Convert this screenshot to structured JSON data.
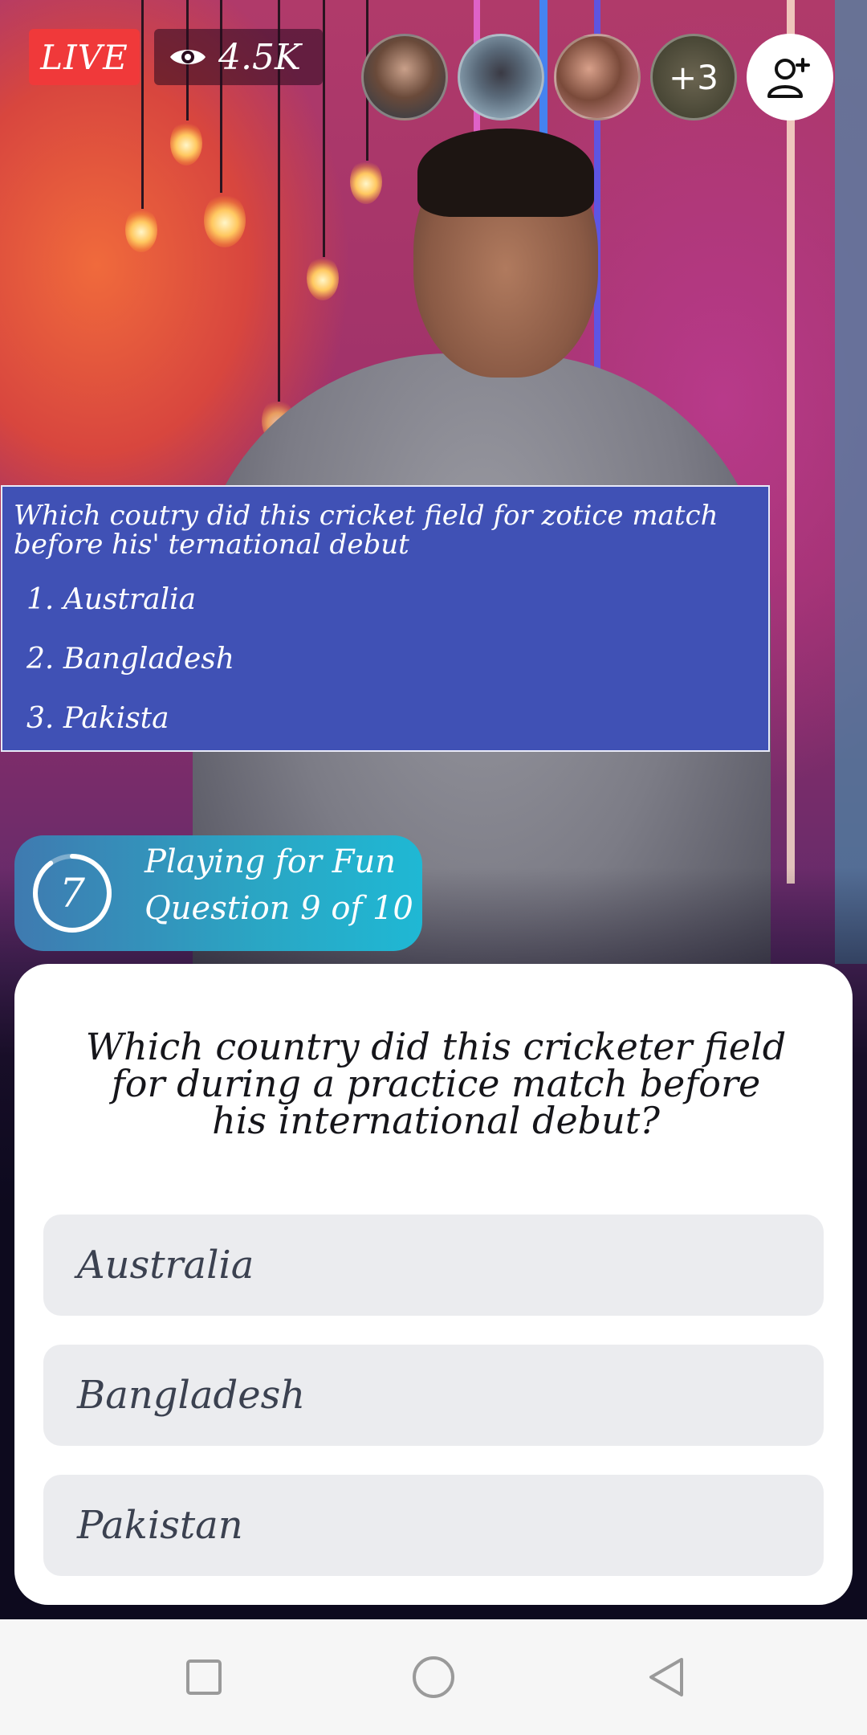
{
  "status_bar": {
    "live_label": "LIVE",
    "viewer_count": "4.5K",
    "more_viewers": "+3"
  },
  "overlay": {
    "question": "Which coutry did this cricket field for zotice match before his' ternational debut",
    "options": [
      {
        "num": "1.",
        "label": "Australia"
      },
      {
        "num": "2.",
        "label": "Bangladesh"
      },
      {
        "num": "3.",
        "label": "Pakista"
      }
    ]
  },
  "game_status": {
    "timer": "7",
    "mode": "Playing for Fun",
    "progress": "Question 9 of 10"
  },
  "card": {
    "question": "Which country did this cricketer field for during a practice match before his international debut?",
    "answers": [
      "Australia",
      "Bangladesh",
      "Pakistan"
    ]
  },
  "icons": {
    "eye": "eye-icon",
    "add_friend": "add-user-icon",
    "nav": [
      "square-icon",
      "circle-icon",
      "triangle-back-icon"
    ]
  },
  "colors": {
    "live": "#f0393a",
    "overlay": "#4051b5",
    "answer_bg": "#ebecef"
  }
}
